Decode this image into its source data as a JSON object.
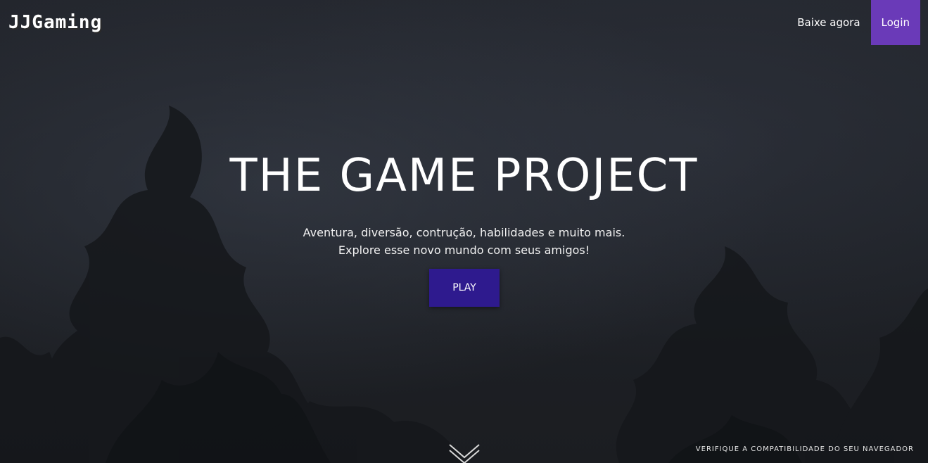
{
  "header": {
    "logo": "JJGaming",
    "nav": {
      "download_label": "Baixe agora",
      "login_label": "Login"
    }
  },
  "hero": {
    "title": "THE GAME PROJECT",
    "subtitle_line1": "Aventura, diversão, contrução, habilidades e muito mais.",
    "subtitle_line2": "Explore esse novo mundo com seus amigos!",
    "play_label": "PLAY"
  },
  "footer": {
    "compat_link": "VERIFIQUE A COMPATIBILIDADE DO SEU NAVEGADOR",
    "scroll_icon": "chevrons-down-icon"
  },
  "colors": {
    "login_bg": "#6a3ab8",
    "play_bg": "#2e1a8e",
    "overlay": "#1e2026"
  }
}
